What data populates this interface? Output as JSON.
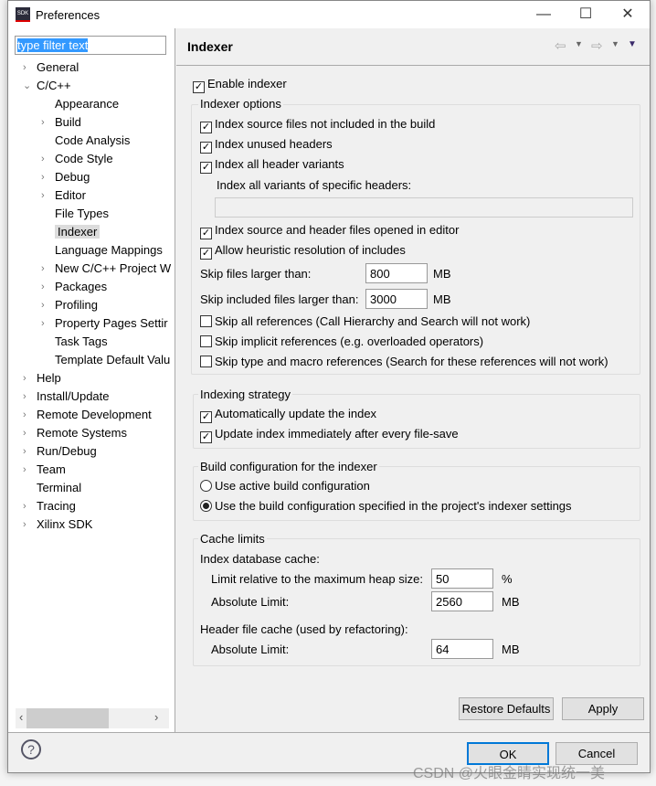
{
  "window": {
    "title": "Preferences",
    "icon_text": "SDK",
    "minimize": "—",
    "maximize": "☐",
    "close": "✕"
  },
  "filter": {
    "value": "type filter text"
  },
  "tree": [
    {
      "label": "General",
      "chev": "›",
      "level": 0
    },
    {
      "label": "C/C++",
      "chev": "⌄",
      "level": 0
    },
    {
      "label": "Appearance",
      "chev": "",
      "level": 1
    },
    {
      "label": "Build",
      "chev": "›",
      "level": 1
    },
    {
      "label": "Code Analysis",
      "chev": "",
      "level": 1
    },
    {
      "label": "Code Style",
      "chev": "›",
      "level": 1
    },
    {
      "label": "Debug",
      "chev": "›",
      "level": 1
    },
    {
      "label": "Editor",
      "chev": "›",
      "level": 1
    },
    {
      "label": "File Types",
      "chev": "",
      "level": 1
    },
    {
      "label": "Indexer",
      "chev": "",
      "level": 1,
      "selected": true
    },
    {
      "label": "Language Mappings",
      "chev": "",
      "level": 1
    },
    {
      "label": "New C/C++ Project W",
      "chev": "›",
      "level": 1
    },
    {
      "label": "Packages",
      "chev": "›",
      "level": 1
    },
    {
      "label": "Profiling",
      "chev": "›",
      "level": 1
    },
    {
      "label": "Property Pages Settir",
      "chev": "›",
      "level": 1
    },
    {
      "label": "Task Tags",
      "chev": "",
      "level": 1
    },
    {
      "label": "Template Default Valu",
      "chev": "",
      "level": 1
    },
    {
      "label": "Help",
      "chev": "›",
      "level": 0
    },
    {
      "label": "Install/Update",
      "chev": "›",
      "level": 0
    },
    {
      "label": "Remote Development",
      "chev": "›",
      "level": 0
    },
    {
      "label": "Remote Systems",
      "chev": "›",
      "level": 0
    },
    {
      "label": "Run/Debug",
      "chev": "›",
      "level": 0
    },
    {
      "label": "Team",
      "chev": "›",
      "level": 0
    },
    {
      "label": "Terminal",
      "chev": "",
      "level": 0
    },
    {
      "label": "Tracing",
      "chev": "›",
      "level": 0
    },
    {
      "label": "Xilinx SDK",
      "chev": "›",
      "level": 0
    }
  ],
  "page": {
    "title": "Indexer",
    "enable_indexer": "Enable indexer",
    "indexer_options": {
      "label": "Indexer options",
      "opt1": "Index source files not included in the build",
      "opt2": "Index unused headers",
      "opt3": "Index all header variants",
      "variants_label": "Index all variants of specific headers:",
      "variants_value": "",
      "opt4": "Index source and header files opened in editor",
      "opt5": "Allow heuristic resolution of includes",
      "skip_larger": "Skip files larger than:",
      "skip_larger_value": "800",
      "mb1": "MB",
      "skip_included": "Skip included files larger than:",
      "skip_included_value": "3000",
      "mb2": "MB",
      "skip_all": "Skip all references (Call Hierarchy and Search will not work)",
      "skip_implicit": "Skip implicit references (e.g. overloaded operators)",
      "skip_type": "Skip type and macro references (Search for these references will not work)"
    },
    "strategy": {
      "label": "Indexing strategy",
      "auto": "Automatically update the index",
      "immediate": "Update index immediately after every file-save"
    },
    "build_config": {
      "label": "Build configuration for the indexer",
      "active": "Use active build configuration",
      "specified": "Use the build configuration specified in the project's indexer settings"
    },
    "cache": {
      "label": "Cache limits",
      "db": "Index database cache:",
      "relative": "Limit relative to the maximum heap size:",
      "relative_value": "50",
      "pct": "%",
      "abs1": "Absolute Limit:",
      "abs1_value": "2560",
      "mb3": "MB",
      "header": "Header file cache (used by refactoring):",
      "abs2": "Absolute Limit:",
      "abs2_value": "64",
      "mb4": "MB"
    }
  },
  "buttons": {
    "restore": "Restore Defaults",
    "apply": "Apply",
    "ok": "OK",
    "cancel": "Cancel"
  },
  "watermark": "CSDN @火眼金睛实现统一美"
}
